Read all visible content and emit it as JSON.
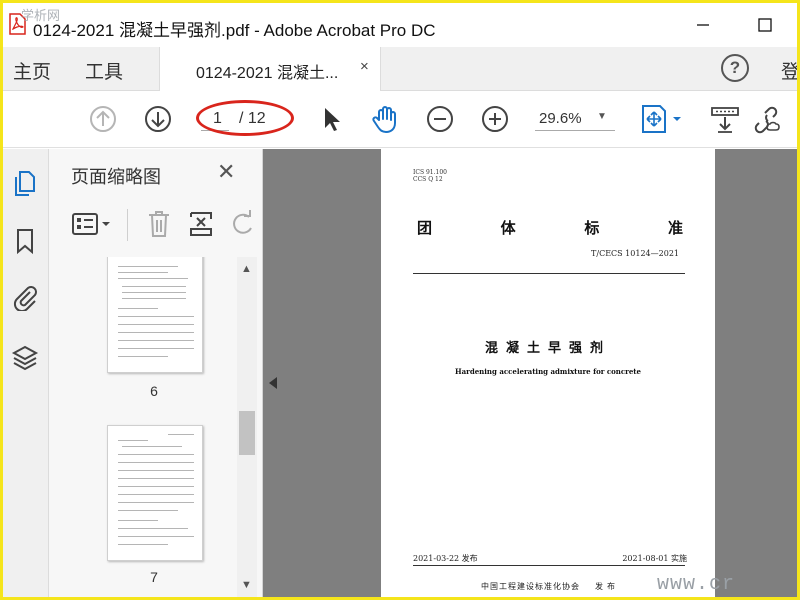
{
  "window": {
    "title": "0124-2021 混凝土早强剂.pdf - Adobe Acrobat Pro DC",
    "watermark_top": "学析网",
    "watermark_bottom": "www.cr"
  },
  "menu": {
    "home": "主页",
    "tools": "工具",
    "doc_tab": "0124-2021 混凝土...",
    "tab_close": "×",
    "help": "?",
    "login": "登"
  },
  "toolbar": {
    "page_current": "1",
    "page_total": "/ 12",
    "zoom": "29.6%",
    "zoom_caret": "▼",
    "highlight_color": "#d9251c",
    "accent_color": "#1a73c7"
  },
  "thumbnail_panel": {
    "title": "页面缩略图",
    "close": "✕",
    "thumbnails": [
      {
        "number": "6"
      },
      {
        "number": "7"
      }
    ]
  },
  "document": {
    "ics": "ICS 91.100",
    "ccs": "CCS Q 12",
    "heading_chars": [
      "团",
      "体",
      "标",
      "准"
    ],
    "standard_code": "T/CECS 10124—2021",
    "title": "混凝土早强剂",
    "subtitle": "Hardening accelerating admixture for concrete",
    "issue_date": "2021-03-22 发布",
    "implement_date": "2021-08-01 实施",
    "publisher": "中国工程建设标准化协会",
    "published": "发布"
  },
  "icons": [
    "pdf-logo-icon",
    "minimize-icon",
    "maximize-icon",
    "prev-page-icon",
    "next-page-icon",
    "select-cursor-icon",
    "hand-tool-icon",
    "zoom-out-icon",
    "zoom-in-icon",
    "fit-page-icon",
    "scroll-mode-icon",
    "share-link-icon",
    "page-thumbnails-icon",
    "bookmark-icon",
    "attachment-icon",
    "layers-icon",
    "thumbnail-options-icon",
    "delete-icon",
    "extract-icon",
    "rotate-icon"
  ]
}
